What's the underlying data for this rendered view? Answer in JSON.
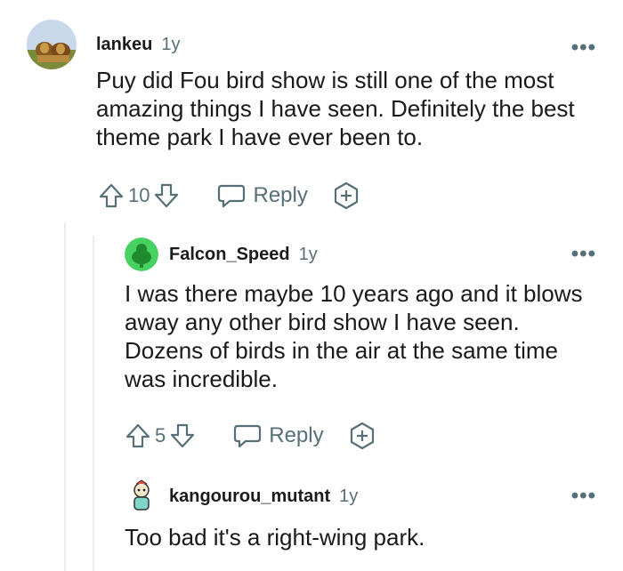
{
  "comments": [
    {
      "author": "lankeu",
      "age": "1y",
      "menu": "•••",
      "body": "Puy did Fou bird show is still one of the most amazing things I have seen. Definitely the best theme park I have ever been to.",
      "score": "10",
      "reply_label": "Reply"
    },
    {
      "author": "Falcon_Speed",
      "age": "1y",
      "menu": "•••",
      "body": "I was there maybe 10 years ago and it blows away any other bird show I have seen. Dozens of birds in the air at the same time was incredible.",
      "score": "5",
      "reply_label": "Reply"
    },
    {
      "author": "kangourou_mutant",
      "age": "1y",
      "menu": "•••",
      "body": "Too bad it's a right-wing park."
    }
  ],
  "icons": {
    "upvote": "upvote-arrow-icon",
    "downvote": "downvote-arrow-icon",
    "reply": "speech-bubble-icon",
    "award": "award-plus-icon"
  }
}
